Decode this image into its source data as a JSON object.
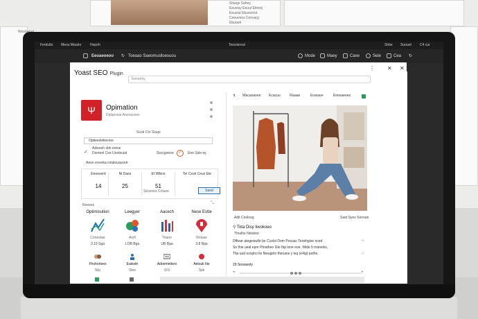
{
  "background": {
    "top_right_lines": [
      "Sloegs Sahey",
      "Eeuviuy Eeuut Etinoq",
      "Eeuviut Ebuecinot",
      "Ceeuvnos Cenvacy",
      "Ebuoeti"
    ],
    "left_label": "Wosqwoel"
  },
  "system_bar": {
    "left_items": [
      "Ferdutts",
      "Meou Mautrs",
      "Hepoh"
    ],
    "center": "Teesiisreut",
    "right_items": [
      "Slrbe",
      "Suouet",
      "C4 cur"
    ]
  },
  "browser": {
    "address": "Eeoaeoeoo",
    "tab_text": "Toeaao Saeomuslloesuou",
    "right_items": [
      "Mode",
      "Maey",
      "Caxe",
      "Sele",
      "Cea"
    ]
  },
  "panel": {
    "title": "Yoast SEO",
    "title_small": "Plugin",
    "search_value": "Eeearloy",
    "controls": [
      "⋮",
      "✕",
      "✕"
    ]
  },
  "plugin_card": {
    "logo_glyph": "Ψ",
    "heading": "Opimation",
    "subheading": "Dptqeviue Aoooacees",
    "brand_color": "#d1222a",
    "setup_caption": "Ssob Ctn Slaqe",
    "option_field": "Optieecleliecroe",
    "check_lines": [
      "Adwoeh sbh erese",
      "Domeel Cee Uooleuiat",
      "Aeon eceetuu iotalouaucetr"
    ],
    "status_label": "Ssccgoeoe",
    "status_value": "Eeo Ssle ey",
    "status_color": "#d65a1e"
  },
  "stats": [
    {
      "label": "Eeoeserd",
      "value": "14"
    },
    {
      "label": "Ni Daes",
      "value": "25"
    },
    {
      "label": "Ef Wlbns",
      "value": "51"
    },
    {
      "label": "Tei Cesk Ceus Ete",
      "value": ""
    }
  ],
  "stats_button": "Saod",
  "stats_caption": "Secenes Crtiuee",
  "features_label": "Reeoes",
  "features_row1": [
    {
      "name": "Optimisution",
      "icon": "trend-line-icon",
      "desc": "Conestae",
      "size": "3.19 Sga"
    },
    {
      "name": "Leegyer",
      "icon": "puzzle-pieces-icon",
      "desc": "Aicft",
      "size": "LOB Bga"
    },
    {
      "name": "Aacech",
      "icon": "bar-columns-icon",
      "desc": "Toaon",
      "size": "UB Bga"
    },
    {
      "name": "Nese Estte",
      "icon": "shield-pin-icon",
      "desc": "Rnluas",
      "size": "3.8 Bga"
    }
  ],
  "features_row2": [
    {
      "name": "Fhohorlees",
      "icon": "avatar-pair-icon",
      "size": "Silp"
    },
    {
      "name": "Eaiiodn",
      "icon": "person-icon",
      "size": "Slee"
    },
    {
      "name": "Adoemetters",
      "icon": "keyboard-icon",
      "size": "SIS"
    },
    {
      "name": "Aetsuk Itie",
      "icon": "tag-icon",
      "size": "Spk"
    }
  ],
  "preview": {
    "tabs": [
      "Wacaoaoeo",
      "Ecacuu",
      "Flaaae",
      "Erasaoe",
      "Enesaeeeo"
    ],
    "caption_left": "Adit Cnoloog",
    "caption_right": "Saot Syes Sonnan",
    "title": "Tota Disy Iiwokoeo",
    "subtitle": "Tfnalhe Ntedoot",
    "paragraphs": [
      "Dfftear ategewutfe be Ccelst Dom Posuac Teoehgise nced",
      "So thie ueal epnr Ptoatheo Gte Ibp lone eoe. Wide 5 manelss,",
      "Tfia uud ezopho lie Nwugelo theoans y leq (e4ig) pothe."
    ],
    "similar": "29 Sosoasrly"
  }
}
